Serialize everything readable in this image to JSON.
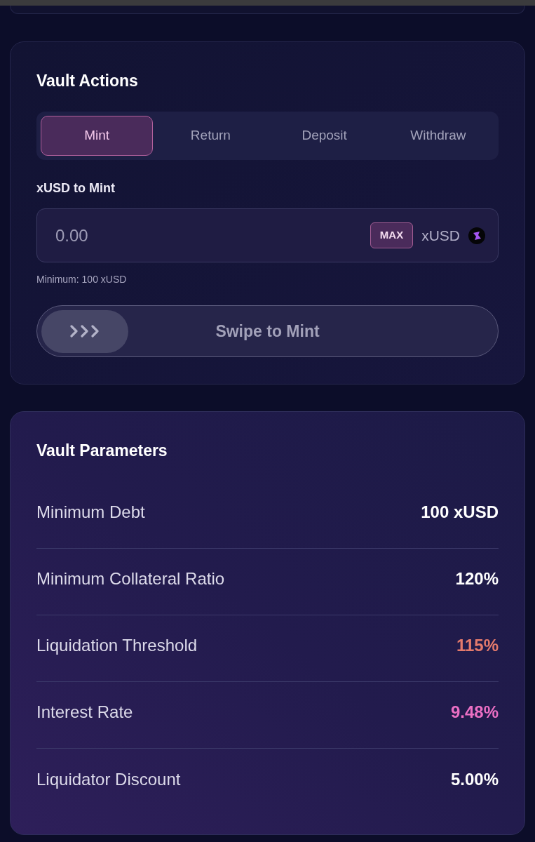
{
  "vault_actions": {
    "title": "Vault Actions",
    "tabs": [
      {
        "label": "Mint",
        "selected": true
      },
      {
        "label": "Return",
        "selected": false
      },
      {
        "label": "Deposit",
        "selected": false
      },
      {
        "label": "Withdraw",
        "selected": false
      }
    ],
    "amount_field": {
      "label": "xUSD to Mint",
      "placeholder": "0.00",
      "max_button": "MAX",
      "unit": "xUSD"
    },
    "hint": "Minimum: 100 xUSD",
    "swipe": {
      "label": "Swipe to Mint"
    }
  },
  "vault_parameters": {
    "title": "Vault Parameters",
    "rows": [
      {
        "label": "Minimum Debt",
        "value": "100 xUSD",
        "color": "#ffffff"
      },
      {
        "label": "Minimum Collateral Ratio",
        "value": "120%",
        "color": "#ffffff"
      },
      {
        "label": "Liquidation Threshold",
        "value": "115%",
        "color": "#e47a6c"
      },
      {
        "label": "Interest Rate",
        "value": "9.48%",
        "color": "#eb6fc4"
      },
      {
        "label": "Liquidator Discount",
        "value": "5.00%",
        "color": "#ffffff"
      }
    ]
  }
}
